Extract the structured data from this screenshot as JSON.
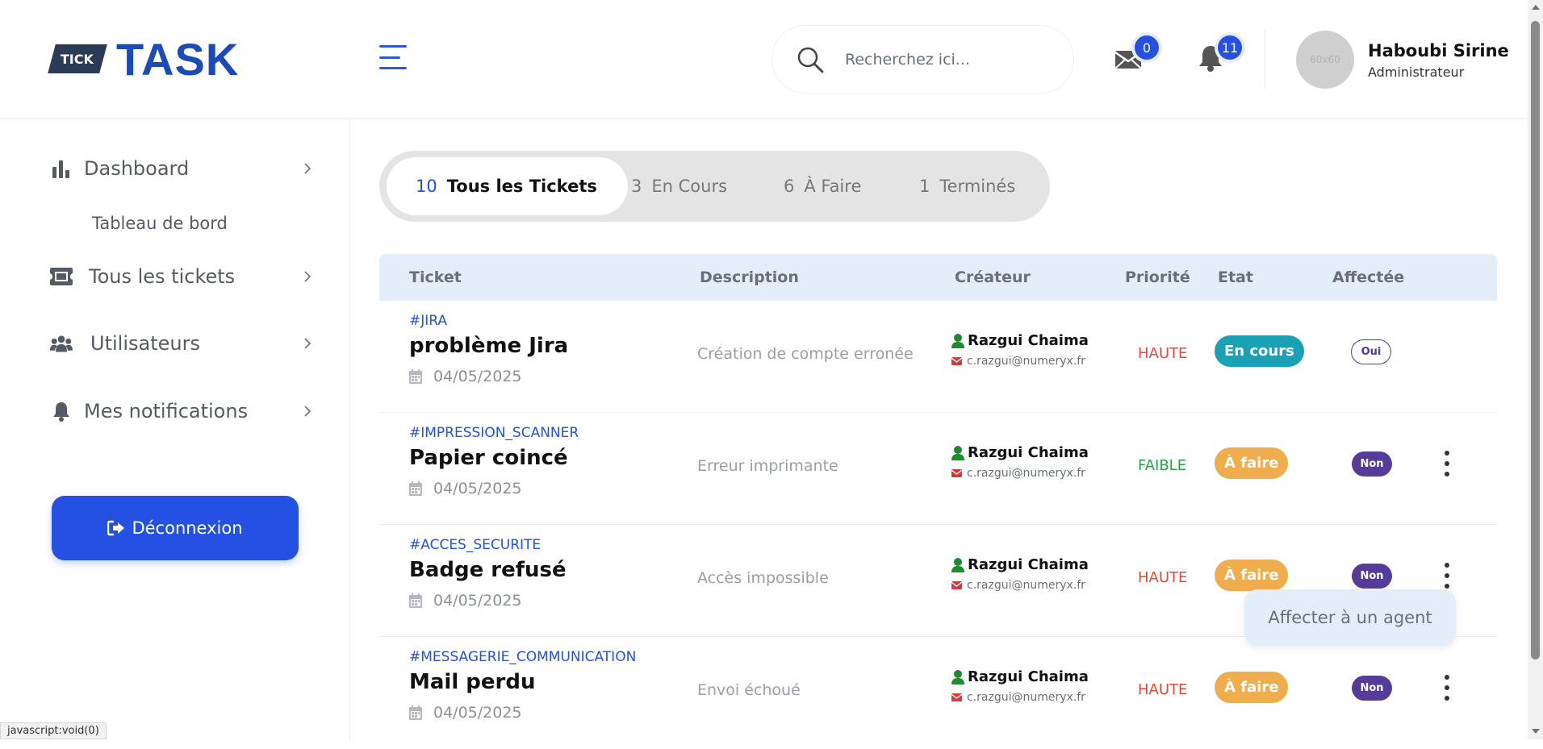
{
  "app": {
    "logo_tag": "TICK",
    "logo_text": "TASK"
  },
  "header": {
    "search_placeholder": "Recherchez ici...",
    "messages_count": "0",
    "notifications_count": "11",
    "avatar_text": "60x60",
    "user_name": "Haboubi Sirine",
    "user_role": "Administrateur"
  },
  "sidebar": {
    "items": [
      {
        "label": "Dashboard",
        "icon": "chart-bar-icon"
      },
      {
        "label": "Tous les tickets",
        "icon": "ticket-icon"
      },
      {
        "label": "Utilisateurs",
        "icon": "users-icon"
      },
      {
        "label": "Mes notifications",
        "icon": "bell-icon"
      }
    ],
    "sub_dashboard": "Tableau de bord",
    "logout_label": "Déconnexion"
  },
  "tabs": [
    {
      "count": "10",
      "label": "Tous les Tickets",
      "active": true
    },
    {
      "count": "3",
      "label": "En Cours",
      "active": false
    },
    {
      "count": "6",
      "label": "À Faire",
      "active": false
    },
    {
      "count": "1",
      "label": "Terminés",
      "active": false
    }
  ],
  "table": {
    "headers": [
      "Ticket",
      "Description",
      "Créateur",
      "Priorité",
      "Etat",
      "Affectée"
    ],
    "rows": [
      {
        "code": "#JIRA",
        "title": "problème Jira",
        "date": "04/05/2025",
        "description": "Création de compte erronée",
        "creator": "Razgui Chaima",
        "email": "c.razgui@numeryx.fr",
        "priority": "HAUTE",
        "state": "En cours",
        "assigned": "Oui"
      },
      {
        "code": "#IMPRESSION_SCANNER",
        "title": "Papier coincé",
        "date": "04/05/2025",
        "description": "Erreur imprimante",
        "creator": "Razgui Chaima",
        "email": "c.razgui@numeryx.fr",
        "priority": "FAIBLE",
        "state": "À faire",
        "assigned": "Non"
      },
      {
        "code": "#ACCES_SECURITE",
        "title": "Badge refusé",
        "date": "04/05/2025",
        "description": "Accès impossible",
        "creator": "Razgui Chaima",
        "email": "c.razgui@numeryx.fr",
        "priority": "HAUTE",
        "state": "À faire",
        "assigned": "Non"
      },
      {
        "code": "#MESSAGERIE_COMMUNICATION",
        "title": "Mail perdu",
        "date": "04/05/2025",
        "description": "Envoi échoué",
        "creator": "Razgui Chaima",
        "email": "c.razgui@numeryx.fr",
        "priority": "HAUTE",
        "state": "À faire",
        "assigned": "Non"
      }
    ]
  },
  "dropdown": {
    "label": "Affecter à un agent"
  },
  "statusbar": {
    "text": "javascript:void(0)"
  },
  "colors": {
    "accent": "#2450e3",
    "priority_high": "#e14a3c",
    "priority_low": "#27a046",
    "state_in_progress": "#1aa1b5",
    "state_todo": "#f0ad4e",
    "assigned_no": "#553c9a",
    "assigned_yes_text": "#553c9a"
  }
}
